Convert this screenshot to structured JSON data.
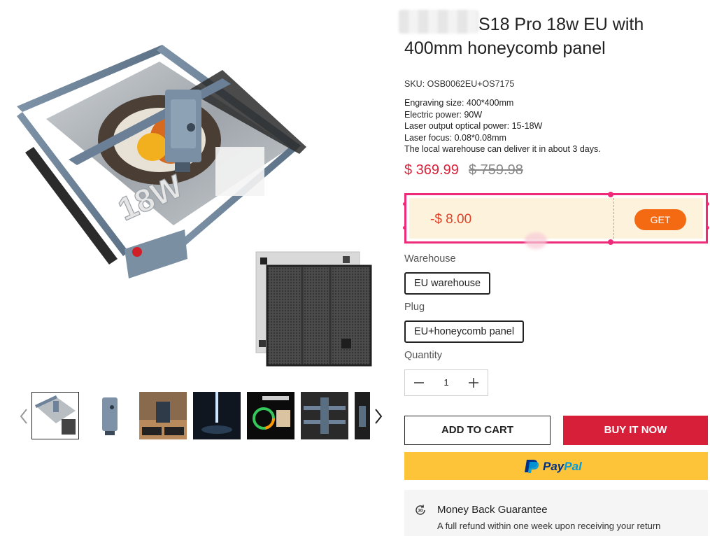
{
  "product": {
    "title": "S18 Pro 18w EU with 400mm honeycomb panel",
    "sku": "SKU: OSB0062EU+OS7175",
    "specs": [
      "Engraving size: 400*400mm",
      "Electric power: 90W",
      "Laser output optical power: 15-18W",
      "Laser focus: 0.08*0.08mm",
      "The local warehouse can deliver it in about 3 days."
    ],
    "price_current": "$ 369.99",
    "price_old": "$ 759.98",
    "image_badge": "18W"
  },
  "coupon": {
    "amount": "-$ 8.00",
    "button": "GET"
  },
  "options": {
    "warehouse_label": "Warehouse",
    "warehouse_value": "EU warehouse",
    "plug_label": "Plug",
    "plug_value": "EU+honeycomb panel"
  },
  "quantity": {
    "label": "Quantity",
    "value": "1"
  },
  "actions": {
    "add_to_cart": "ADD TO CART",
    "buy_now": "BUY IT NOW",
    "paypal": "PayPal"
  },
  "guarantee": {
    "icon_text": "30",
    "title": "Money Back Guarantee",
    "text": "A full refund within one week upon receiving your return"
  },
  "thumbnails": [
    "thumb-laser-machine",
    "thumb-laser-module",
    "thumb-18w-box",
    "thumb-laser-focus",
    "thumb-30000-hours",
    "thumb-machine-frame",
    "thumb-partial"
  ],
  "icons": {
    "prev": "chevron-left-icon",
    "next": "chevron-right-icon",
    "minus": "minus-icon",
    "plus": "plus-icon",
    "guarantee": "money-back-icon"
  },
  "colors": {
    "price": "#d9213a",
    "coupon_border": "#ef2a79",
    "coupon_bg": "#fdf3dc",
    "get_button": "#f36a12",
    "buy_now": "#d71f3a",
    "paypal_bg": "#fdc439"
  }
}
